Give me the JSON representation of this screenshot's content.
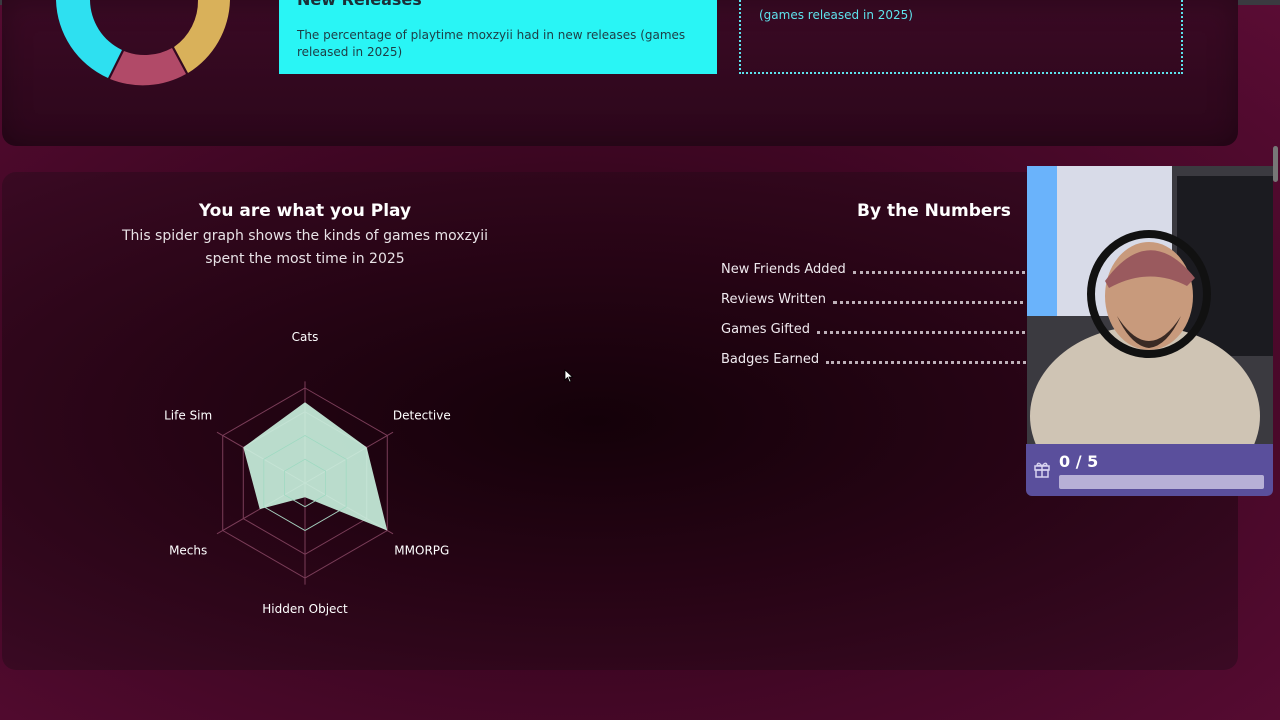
{
  "top_cards": {
    "new_releases": {
      "heading": "New Releases",
      "description": "The percentage of playtime moxzyii had in new releases (games released in 2025)"
    },
    "dotted_card_text": "(games released in 2025)"
  },
  "donut": {
    "segments": [
      {
        "name": "cyan",
        "color": "#2ee0f0"
      },
      {
        "name": "rose",
        "color": "#b14a68"
      },
      {
        "name": "gold",
        "color": "#d9b15a"
      }
    ]
  },
  "play_section": {
    "title": "You are what you Play",
    "subtitle_line1": "This spider graph shows the kinds of games moxzyii",
    "subtitle_line2": "spent the most time in 2025"
  },
  "chart_data": {
    "type": "radar",
    "categories": [
      "Cats",
      "Detective",
      "MMORPG",
      "Hidden Object",
      "Mechs",
      "Life Sim"
    ],
    "values": [
      0.85,
      0.75,
      1.0,
      0.15,
      0.55,
      0.75
    ],
    "fill_color": "#cffbe6",
    "grid": true
  },
  "numbers_section": {
    "title": "By the Numbers",
    "stats": [
      {
        "label": "New Friends Added"
      },
      {
        "label": "Reviews Written"
      },
      {
        "label": "Games Gifted"
      },
      {
        "label": "Badges Earned"
      }
    ]
  },
  "goal_widget": {
    "count_text": "0 / 5",
    "progress": 0.0,
    "icon": "gift-icon"
  },
  "colors": {
    "accent_cyan": "#29f5f5",
    "radar_fill": "#cffbe6",
    "goal_bg": "#5a4f9c"
  }
}
